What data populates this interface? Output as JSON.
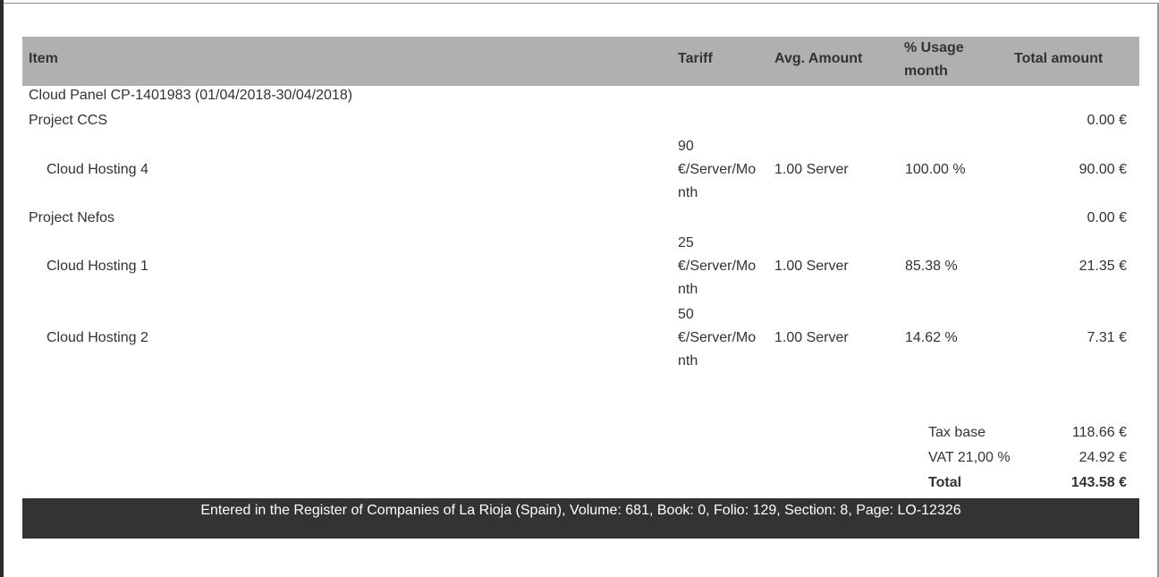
{
  "header": {
    "item": "Item",
    "tariff": "Tariff",
    "avg_amount": "Avg. Amount",
    "usage_line1": "% Usage",
    "usage_line2": "month",
    "total_amount": "Total amount"
  },
  "panel_title": "Cloud Panel CP-1401983 (01/04/2018-30/04/2018)",
  "projects": [
    {
      "name": "Project CCS",
      "total": "0.00 €",
      "items": [
        {
          "name": "Cloud Hosting 4",
          "tariff_lines": [
            "90",
            "€/Server/Mo",
            "nth"
          ],
          "avg_amount": "1.00 Server",
          "usage": "100.00 %",
          "total": "90.00 €"
        }
      ]
    },
    {
      "name": "Project Nefos",
      "total": "0.00 €",
      "items": [
        {
          "name": "Cloud Hosting 1",
          "tariff_lines": [
            "25",
            "€/Server/Mo",
            "nth"
          ],
          "avg_amount": "1.00 Server",
          "usage": "85.38 %",
          "total": "21.35 €"
        },
        {
          "name": "Cloud Hosting 2",
          "tariff_lines": [
            "50",
            "€/Server/Mo",
            "nth"
          ],
          "avg_amount": "1.00 Server",
          "usage": "14.62 %",
          "total": "7.31 €"
        }
      ]
    }
  ],
  "summary": {
    "tax_base_label": "Tax base",
    "tax_base_value": "118.66 €",
    "vat_label": "VAT 21,00 %",
    "vat_value": "24.92 €",
    "total_label": "Total",
    "total_value": "143.58 €"
  },
  "footer": {
    "text": "Entered in the Register of Companies of La Rioja (Spain), Volume: 681, Book: 0, Folio: 129, Section: 8, Page: LO-12326"
  }
}
